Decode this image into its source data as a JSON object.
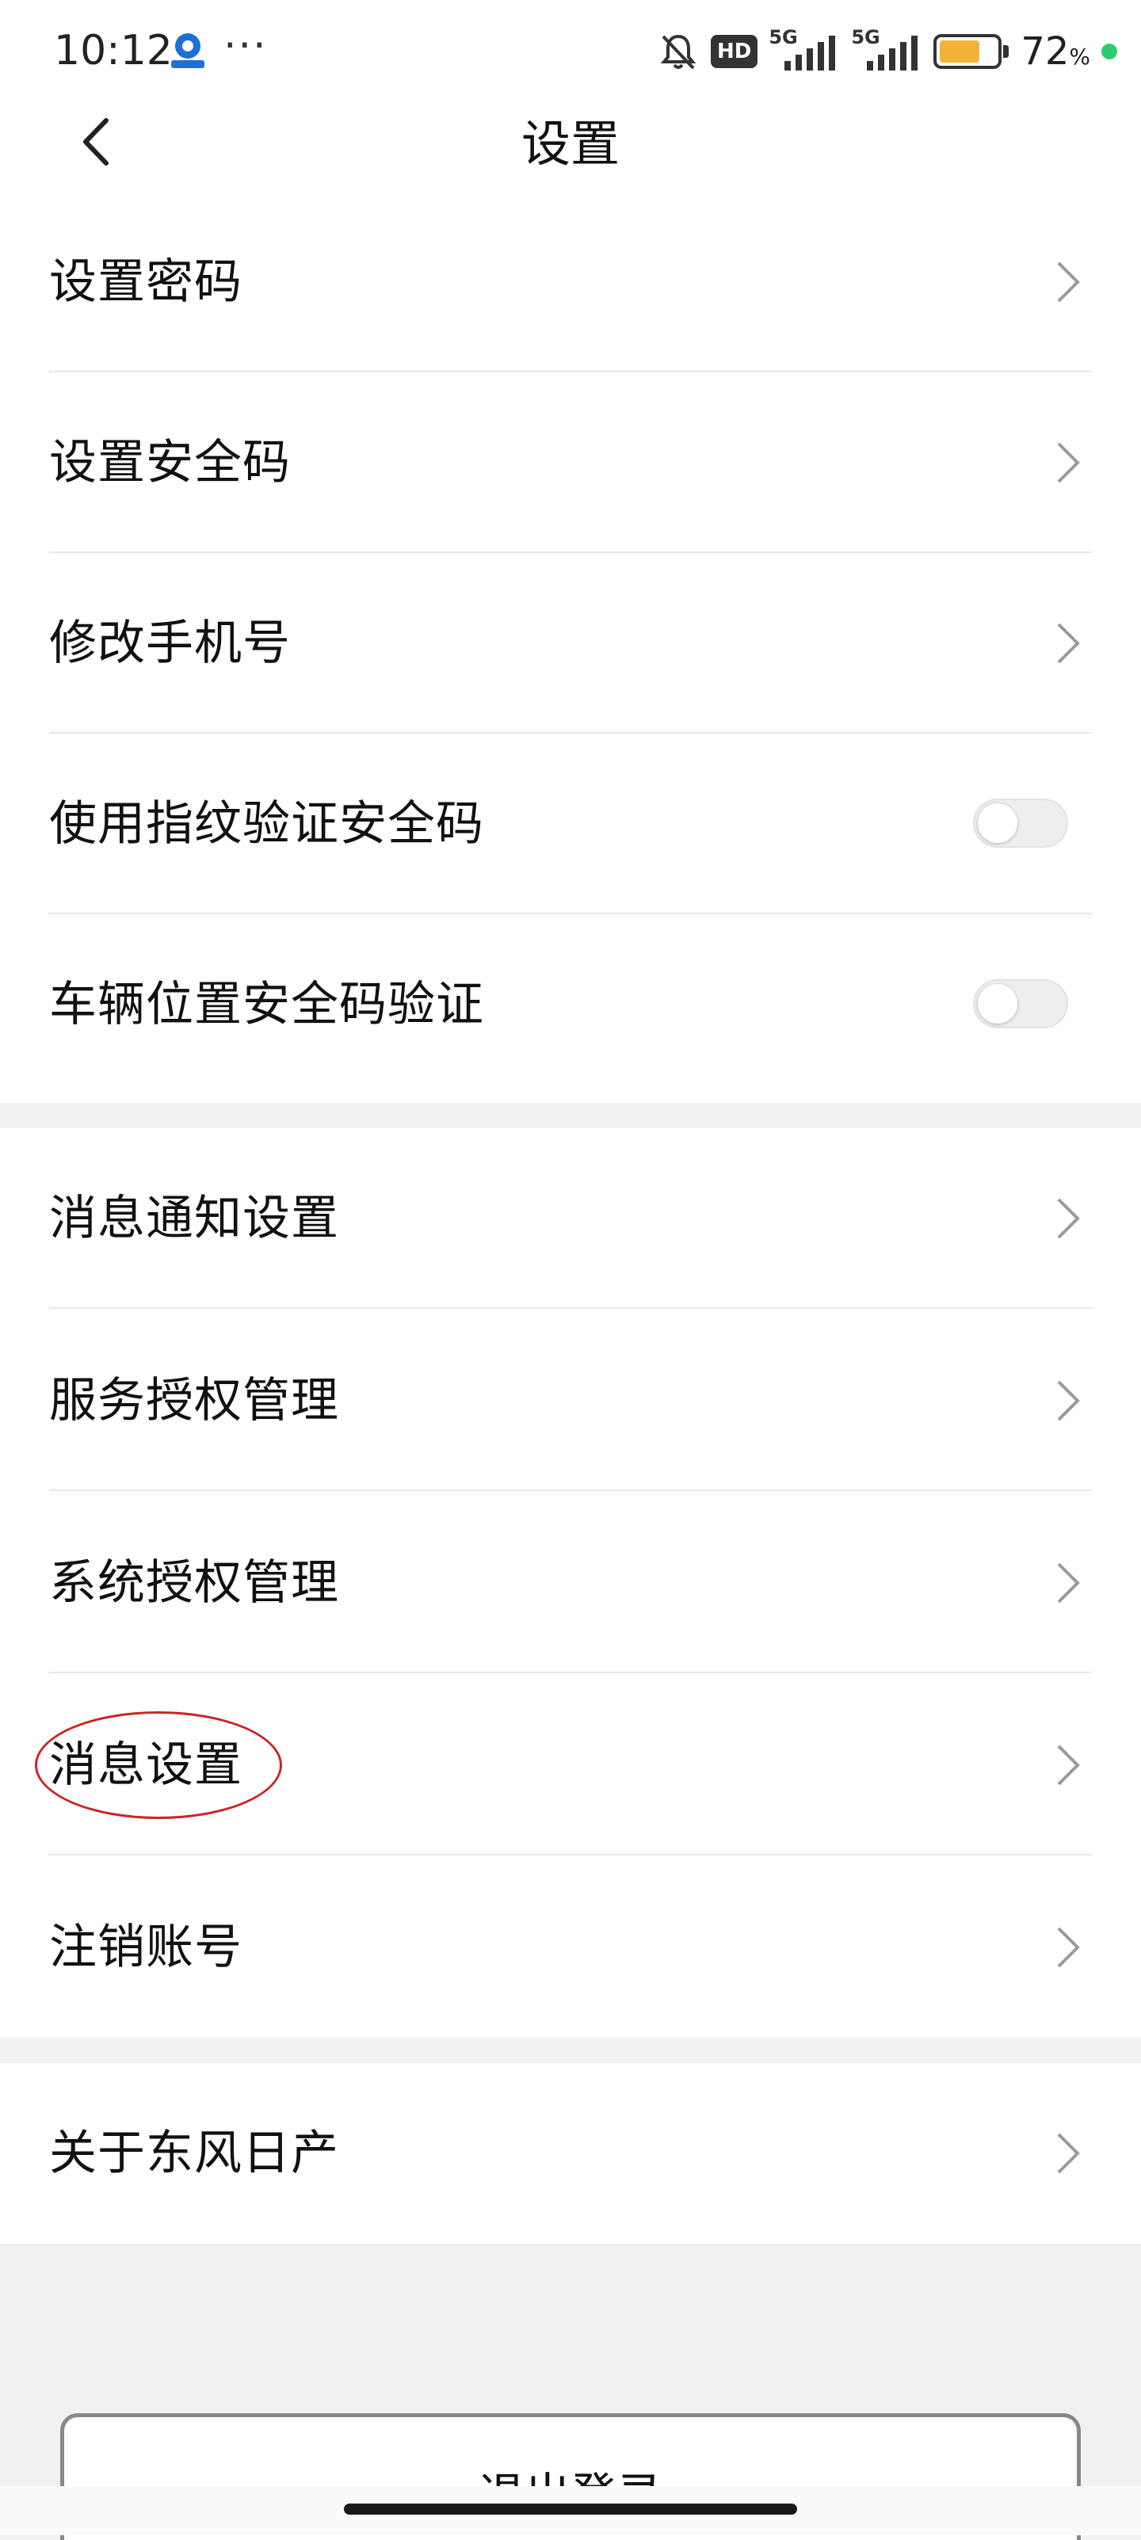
{
  "status_bar": {
    "time": "10:12",
    "dots": "···",
    "signal_1": "5G",
    "signal_2": "5G",
    "hd_badge": "HD",
    "battery_percent": "72",
    "battery_unit": "%",
    "battery_level": 0.72,
    "battery_color": "#f2b233",
    "icons": [
      "app-notification-icon",
      "more-dots-icon",
      "mute-bell-icon",
      "hd-icon",
      "signal-5g-icon",
      "signal-5g-icon",
      "battery-icon",
      "privacy-indicator-dot"
    ]
  },
  "nav": {
    "title": "设置",
    "back_icon": "chevron-left-icon"
  },
  "security_group": [
    {
      "label": "设置密码",
      "control": "chevron"
    },
    {
      "label": "设置安全码",
      "control": "chevron"
    },
    {
      "label": "修改手机号",
      "control": "chevron"
    },
    {
      "label": "使用指纹验证安全码",
      "control": "toggle",
      "toggle_on": false
    },
    {
      "label": "车辆位置安全码验证",
      "control": "toggle",
      "toggle_on": false
    }
  ],
  "settings_group": [
    {
      "label": "消息通知设置",
      "control": "chevron"
    },
    {
      "label": "服务授权管理",
      "control": "chevron"
    },
    {
      "label": "系统授权管理",
      "control": "chevron"
    },
    {
      "label": "消息设置",
      "control": "chevron",
      "highlighted": true
    },
    {
      "label": "注销账号",
      "control": "chevron"
    }
  ],
  "about_group": [
    {
      "label": "关于东风日产",
      "control": "chevron"
    }
  ],
  "logout": {
    "label": "退出登录"
  },
  "colors": {
    "page_bg": "#f1f1f1",
    "card_bg": "#ffffff",
    "highlight": "#c9242a",
    "battery": "#f2b233",
    "privacy_dot": "#2ecc71"
  }
}
